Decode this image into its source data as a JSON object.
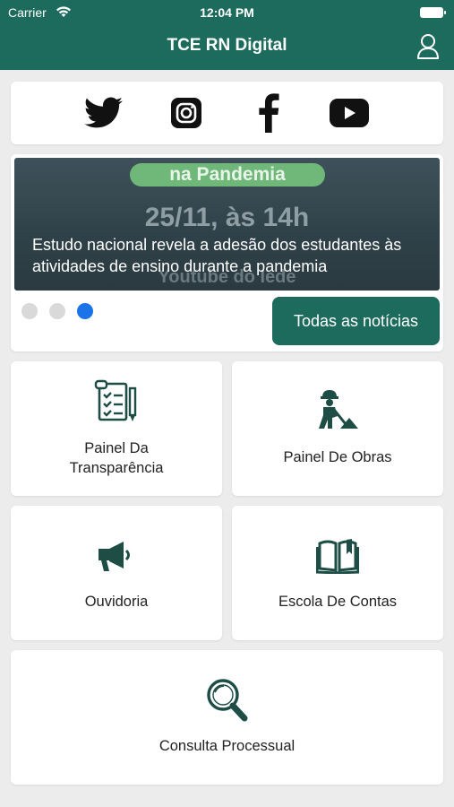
{
  "status_bar": {
    "carrier": "Carrier",
    "time": "12:04 PM"
  },
  "header": {
    "title": "TCE RN Digital"
  },
  "social": [
    {
      "name": "twitter-icon"
    },
    {
      "name": "instagram-icon"
    },
    {
      "name": "facebook-icon"
    },
    {
      "name": "youtube-icon"
    }
  ],
  "news": {
    "banner_tag": "na Pandemia",
    "banner_date": "25/11, às 14h",
    "banner_sub": "Youtube do Iede",
    "headline": "Estudo nacional revela a adesão dos estudantes às atividades de ensino durante a pandemia",
    "carousel": {
      "total": 3,
      "active": 3
    },
    "all_news_label": "Todas as notícias"
  },
  "tiles": {
    "painel_transparencia": "Painel Da\nTransparência",
    "painel_obras": "Painel De Obras",
    "ouvidoria": "Ouvidoria",
    "escola_contas": "Escola De Contas",
    "consulta_processual": "Consulta Processual"
  },
  "colors": {
    "primary": "#1d6b5c",
    "background": "#ececec",
    "active_dot": "#1a73e8",
    "inactive_dot": "#d9d9d9"
  }
}
